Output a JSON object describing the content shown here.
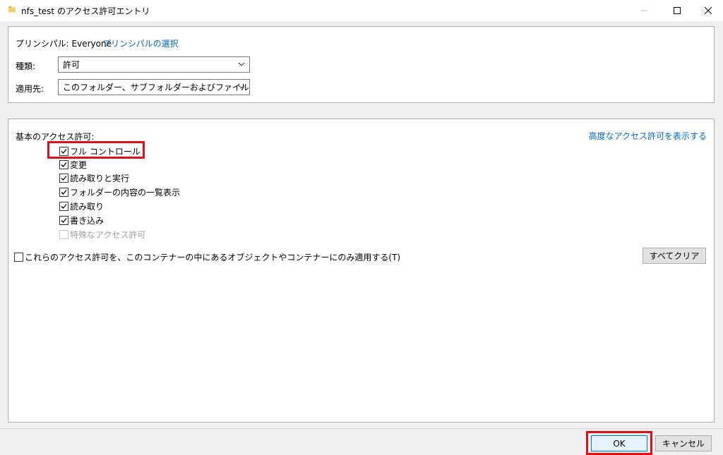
{
  "window": {
    "title": "nfs_test のアクセス許可エントリ",
    "folder_icon_color": "#e8b33c"
  },
  "principal": {
    "label": "プリンシパル:",
    "value": "Everyone",
    "select_link": "プリンシパルの選択"
  },
  "type": {
    "label": "種類:",
    "value": "許可"
  },
  "applies_to": {
    "label": "適用先:",
    "value": "このフォルダー、サブフォルダーおよびファイル"
  },
  "basic": {
    "heading": "基本のアクセス許可:",
    "advanced_link": "高度なアクセス許可を表示する",
    "permissions": [
      {
        "label": "フル コントロール",
        "checked": true,
        "enabled": true
      },
      {
        "label": "変更",
        "checked": true,
        "enabled": true
      },
      {
        "label": "読み取りと実行",
        "checked": true,
        "enabled": true
      },
      {
        "label": "フォルダーの内容の一覧表示",
        "checked": true,
        "enabled": true
      },
      {
        "label": "読み取り",
        "checked": true,
        "enabled": true
      },
      {
        "label": "書き込み",
        "checked": true,
        "enabled": true
      },
      {
        "label": "特殊なアクセス許可",
        "checked": false,
        "enabled": false
      }
    ]
  },
  "apply_only": {
    "label": "これらのアクセス許可を、このコンテナーの中にあるオブジェクトやコンテナーにのみ適用する(T)",
    "checked": false
  },
  "buttons": {
    "clear_all": "すべてクリア",
    "ok": "OK",
    "cancel": "キャンセル"
  },
  "colors": {
    "link": "#0066cc",
    "highlight": "#e0101a",
    "ok_border": "#0078d7"
  }
}
